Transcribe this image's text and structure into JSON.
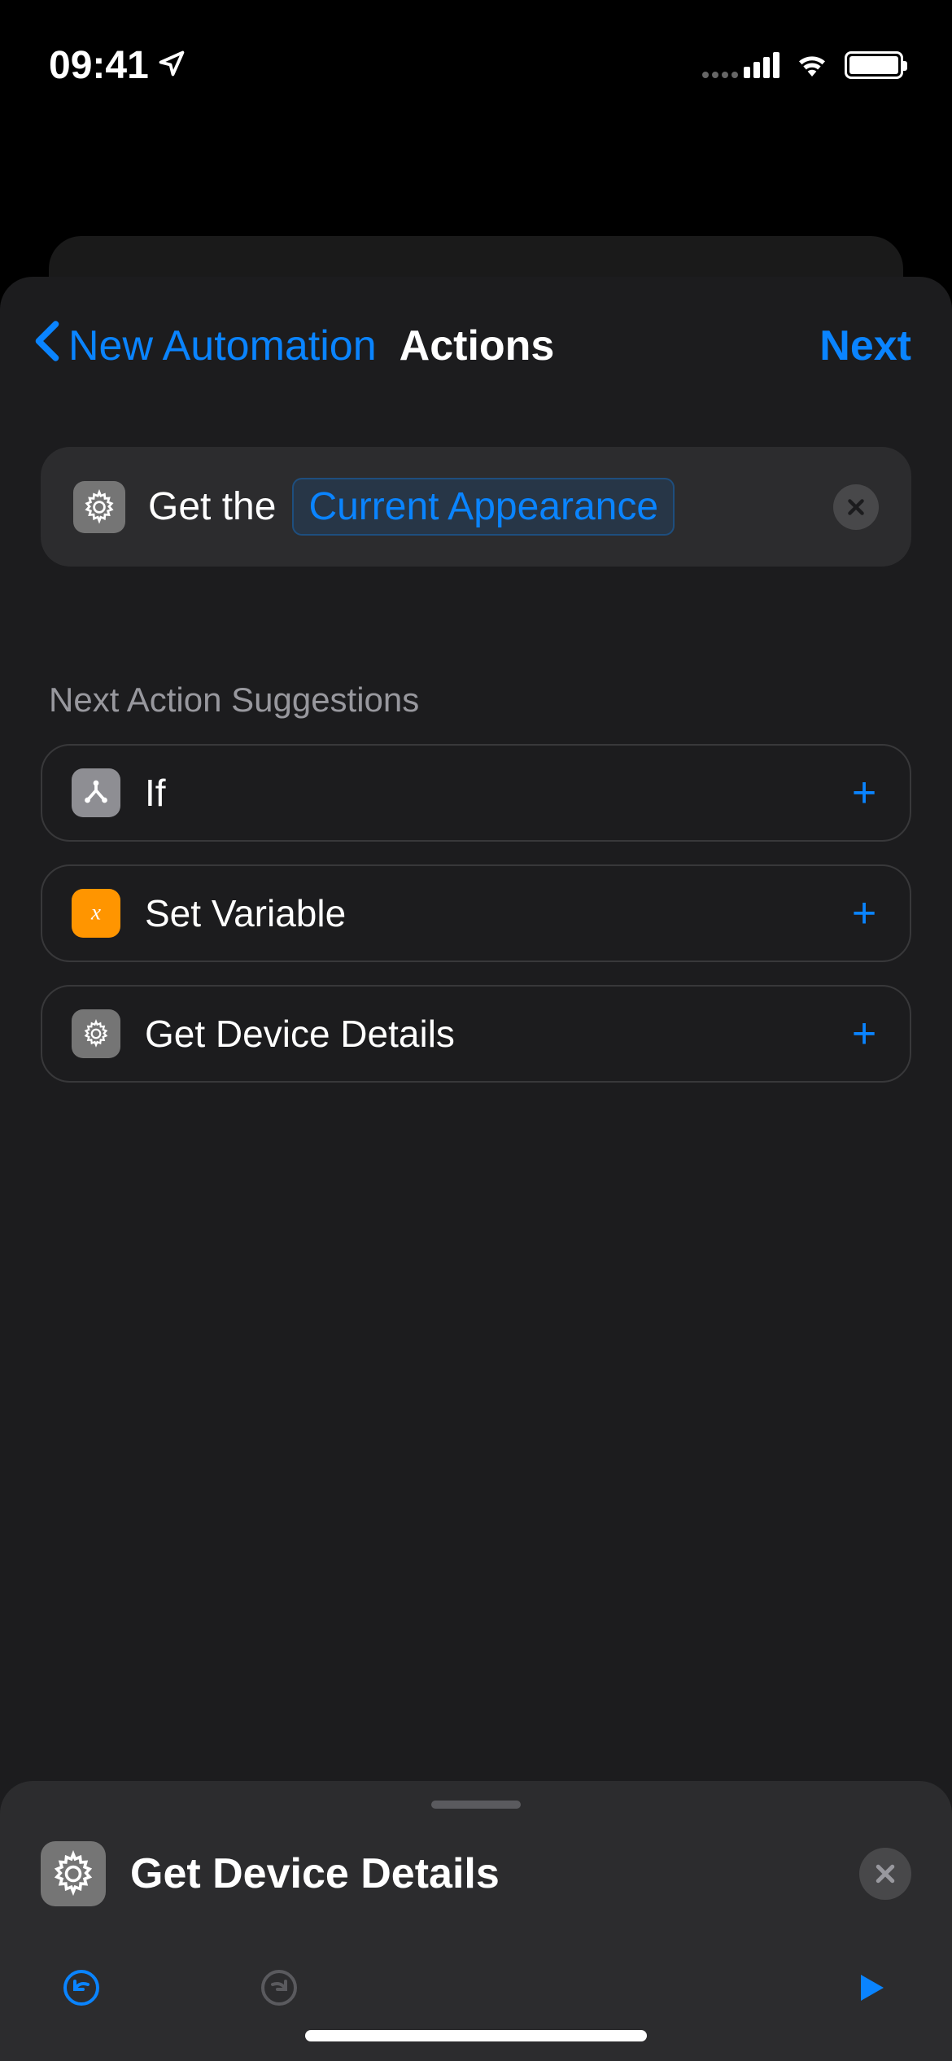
{
  "status_bar": {
    "time": "09:41"
  },
  "nav": {
    "back_label": "New Automation",
    "title": "Actions",
    "next_label": "Next"
  },
  "action_card": {
    "prefix": "Get the",
    "parameter": "Current Appearance"
  },
  "suggestions": {
    "header": "Next Action Suggestions",
    "items": [
      {
        "label": "If",
        "icon": "branch",
        "color": "gray"
      },
      {
        "label": "Set Variable",
        "icon": "variable",
        "color": "orange"
      },
      {
        "label": "Get Device Details",
        "icon": "gear",
        "color": "darkgray"
      }
    ]
  },
  "bottom_panel": {
    "search_text": "Get Device Details"
  },
  "colors": {
    "accent": "#0a84ff",
    "background": "#1c1c1e",
    "card": "#2c2c2e"
  }
}
